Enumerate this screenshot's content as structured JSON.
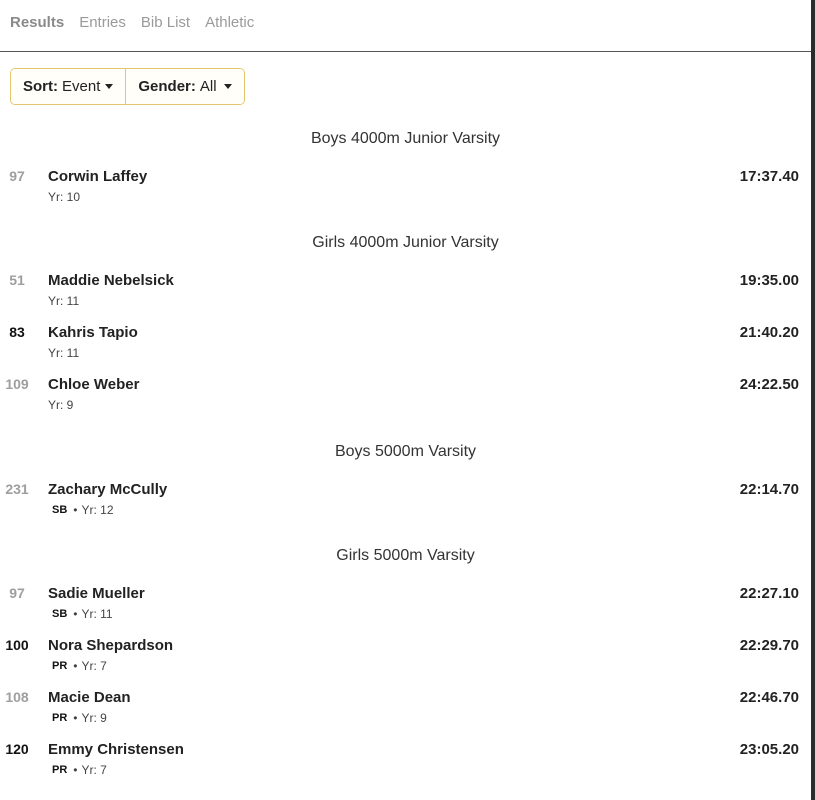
{
  "tabs": [
    {
      "label": "Results",
      "active": true
    },
    {
      "label": "Entries",
      "active": false
    },
    {
      "label": "Bib List",
      "active": false
    },
    {
      "label": "Athletic",
      "active": false
    }
  ],
  "filters": {
    "sort_label": "Sort:",
    "sort_value": "Event",
    "gender_label": "Gender:",
    "gender_value": "All"
  },
  "sections": [
    {
      "title": "Boys 4000m Junior Varsity",
      "rows": [
        {
          "place": "97",
          "place_dark": false,
          "name": "Corwin Laffey",
          "badge": "",
          "year": "Yr: 10",
          "time": "17:37.40"
        }
      ]
    },
    {
      "title": "Girls 4000m Junior Varsity",
      "rows": [
        {
          "place": "51",
          "place_dark": false,
          "name": "Maddie Nebelsick",
          "badge": "",
          "year": "Yr: 11",
          "time": "19:35.00"
        },
        {
          "place": "83",
          "place_dark": true,
          "name": "Kahris Tapio",
          "badge": "",
          "year": "Yr: 11",
          "time": "21:40.20"
        },
        {
          "place": "109",
          "place_dark": false,
          "name": "Chloe Weber",
          "badge": "",
          "year": "Yr: 9",
          "time": "24:22.50"
        }
      ]
    },
    {
      "title": "Boys 5000m Varsity",
      "rows": [
        {
          "place": "231",
          "place_dark": false,
          "name": "Zachary McCully",
          "badge": "SB",
          "year": "Yr: 12",
          "time": "22:14.70"
        }
      ]
    },
    {
      "title": "Girls 5000m Varsity",
      "rows": [
        {
          "place": "97",
          "place_dark": false,
          "name": "Sadie Mueller",
          "badge": "SB",
          "year": "Yr: 11",
          "time": "22:27.10"
        },
        {
          "place": "100",
          "place_dark": true,
          "name": "Nora Shepardson",
          "badge": "PR",
          "year": "Yr: 7",
          "time": "22:29.70"
        },
        {
          "place": "108",
          "place_dark": false,
          "name": "Macie Dean",
          "badge": "PR",
          "year": "Yr: 9",
          "time": "22:46.70"
        },
        {
          "place": "120",
          "place_dark": true,
          "name": "Emmy Christensen",
          "badge": "PR",
          "year": "Yr: 7",
          "time": "23:05.20"
        }
      ]
    }
  ],
  "colors": {
    "filter_border": "#e3c66b",
    "place_muted": "#9e9e9e",
    "place_dark": "#111111"
  }
}
